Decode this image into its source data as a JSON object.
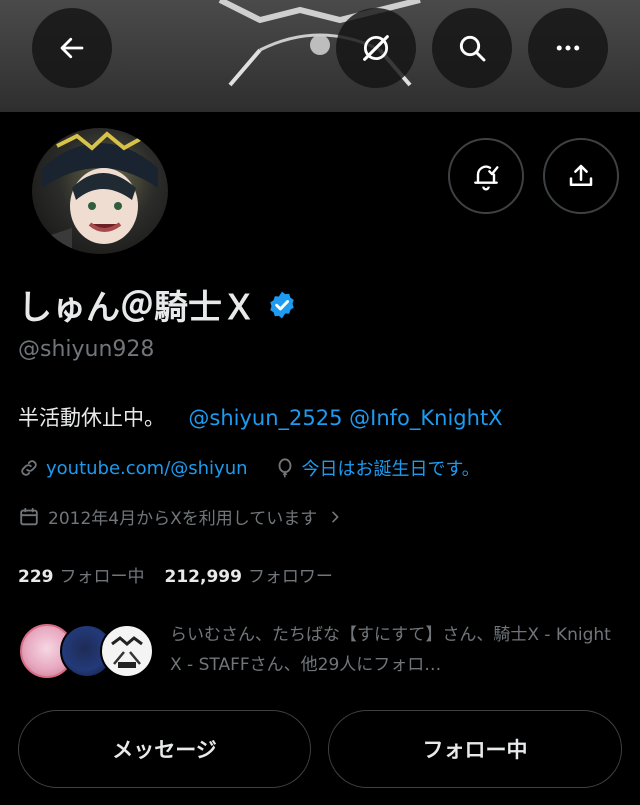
{
  "header": {
    "back_icon": "arrow-left-icon",
    "grok_icon": "grok-icon",
    "search_icon": "search-icon",
    "more_icon": "more-horizontal-icon"
  },
  "profile": {
    "display_name": "しゅん＠騎士Ｘ",
    "verified": true,
    "verified_color": "#1d9bf0",
    "handle": "@shiyun928",
    "bio_text": "半活動休止中。",
    "bio_mentions": [
      "@shiyun_2525",
      "@Info_KnightX"
    ],
    "link": "youtube.com/@shiyun",
    "birthday": "今日はお誕生日です。",
    "joined": "2012年4月からXを利用しています"
  },
  "stats": {
    "following_count": "229",
    "following_label": "フォロー中",
    "followers_count": "212,999",
    "followers_label": "フォロワー"
  },
  "followed_by": {
    "text": "らいむさん、たちばな【すにすて】さん、騎士X - Knight X - STAFFさん、他29人にフォロ…"
  },
  "actions": {
    "message_label": "メッセージ",
    "following_label": "フォロー中"
  },
  "colors": {
    "background": "#000000",
    "accent": "#1d9bf0",
    "secondary_text": "#71767b",
    "border": "#3e4144"
  }
}
